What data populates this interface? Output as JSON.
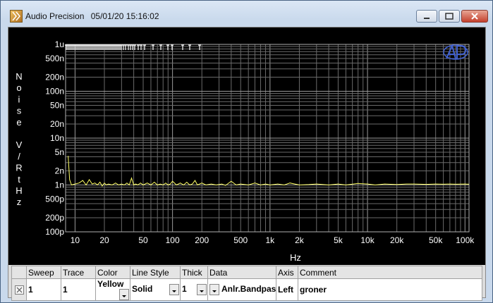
{
  "window": {
    "app_title": "Audio Precision",
    "timestamp": "05/01/20 15:16:02"
  },
  "chart_data": {
    "type": "line",
    "ylabel_chars": [
      "N",
      "o",
      "i",
      "s",
      "e",
      "",
      "V",
      "/",
      "R",
      "t",
      "H",
      "z"
    ],
    "xlabel": "Hz",
    "x_scale": "log",
    "y_scale": "log",
    "xlim": [
      8,
      110000
    ],
    "ylim": [
      1e-10,
      1e-06
    ],
    "grid": true,
    "x_ticks": [
      {
        "v": 10,
        "label": "10"
      },
      {
        "v": 20,
        "label": "20"
      },
      {
        "v": 50,
        "label": "50"
      },
      {
        "v": 100,
        "label": "100"
      },
      {
        "v": 200,
        "label": "200"
      },
      {
        "v": 500,
        "label": "500"
      },
      {
        "v": 1000,
        "label": "1k"
      },
      {
        "v": 2000,
        "label": "2k"
      },
      {
        "v": 5000,
        "label": "5k"
      },
      {
        "v": 10000,
        "label": "10k"
      },
      {
        "v": 20000,
        "label": "20k"
      },
      {
        "v": 50000,
        "label": "50k"
      },
      {
        "v": 100000,
        "label": "100k"
      }
    ],
    "y_ticks": [
      {
        "v": 1e-06,
        "label": "1u"
      },
      {
        "v": 5e-07,
        "label": "500n"
      },
      {
        "v": 2e-07,
        "label": "200n"
      },
      {
        "v": 1e-07,
        "label": "100n"
      },
      {
        "v": 5e-08,
        "label": "50n"
      },
      {
        "v": 2e-08,
        "label": "20n"
      },
      {
        "v": 1e-08,
        "label": "10n"
      },
      {
        "v": 5e-09,
        "label": "5n"
      },
      {
        "v": 2e-09,
        "label": "2n"
      },
      {
        "v": 1e-09,
        "label": "1n"
      },
      {
        "v": 5e-10,
        "label": "500p"
      },
      {
        "v": 2e-10,
        "label": "200p"
      },
      {
        "v": 1e-10,
        "label": "100p"
      }
    ],
    "series": [
      {
        "color": "#ffff66",
        "x": [
          8.5,
          8.8,
          9.2,
          10,
          11,
          12,
          13,
          14,
          15,
          16,
          17,
          18,
          19,
          20,
          21,
          22,
          24,
          26,
          28,
          30,
          32,
          34,
          36,
          38,
          40,
          42,
          44,
          47,
          50,
          55,
          60,
          65,
          70,
          75,
          80,
          85,
          90,
          95,
          100,
          110,
          120,
          130,
          140,
          150,
          160,
          170,
          180,
          200,
          220,
          250,
          280,
          320,
          350,
          400,
          450,
          500,
          600,
          700,
          800,
          900,
          1000,
          1200,
          1400,
          1600,
          2000,
          2500,
          3000,
          4000,
          5000,
          6000,
          8000,
          10000,
          12000,
          15000,
          20000,
          25000,
          30000,
          40000,
          50000,
          60000,
          70000,
          80000,
          100000,
          110000
        ],
        "y": [
          4.2e-09,
          1.3e-09,
          1e-09,
          1.05e-09,
          1.1e-09,
          1.25e-09,
          1e-09,
          1.3e-09,
          1.05e-09,
          1.1e-09,
          1e-09,
          1.15e-09,
          9.5e-10,
          1.1e-09,
          1e-09,
          1.05e-09,
          1e-09,
          1.1e-09,
          1e-09,
          1.05e-09,
          1e-09,
          1.1e-09,
          1e-09,
          1.4e-09,
          1e-09,
          1.05e-09,
          1e-09,
          1.1e-09,
          1e-09,
          1.1e-09,
          1e-09,
          1.15e-09,
          1e-09,
          1.05e-09,
          1e-09,
          1.1e-09,
          1e-09,
          1.05e-09,
          1.2e-09,
          1e-09,
          1.1e-09,
          1e-09,
          1.15e-09,
          1e-09,
          1.05e-09,
          1.25e-09,
          1e-09,
          1.1e-09,
          1e-09,
          1.05e-09,
          1e-09,
          1.05e-09,
          9.8e-10,
          1.2e-09,
          1e-09,
          1.05e-09,
          1e-09,
          1.1e-09,
          1e-09,
          1.05e-09,
          1e-09,
          1.05e-09,
          1e-09,
          1.1e-09,
          1e-09,
          1.02e-09,
          1.05e-09,
          1e-09,
          1.05e-09,
          1e-09,
          1.08e-09,
          1.05e-09,
          1e-09,
          1.05e-09,
          1.02e-09,
          1.05e-09,
          1.05e-09,
          1.03e-09,
          1.05e-09,
          1.04e-09,
          1.05e-09,
          1.04e-09,
          1.05e-09,
          1.04e-09
        ]
      }
    ]
  },
  "table": {
    "headers": [
      "",
      "Sweep",
      "Trace",
      "Color",
      "Line Style",
      "Thick",
      "Data",
      "Axis",
      "Comment"
    ],
    "row": {
      "sweep": "1",
      "trace": "1",
      "color": "Yellow",
      "line_style": "Solid",
      "thick": "1",
      "data": "Anlr.Bandpass",
      "axis": "Left",
      "comment": "groner"
    }
  }
}
